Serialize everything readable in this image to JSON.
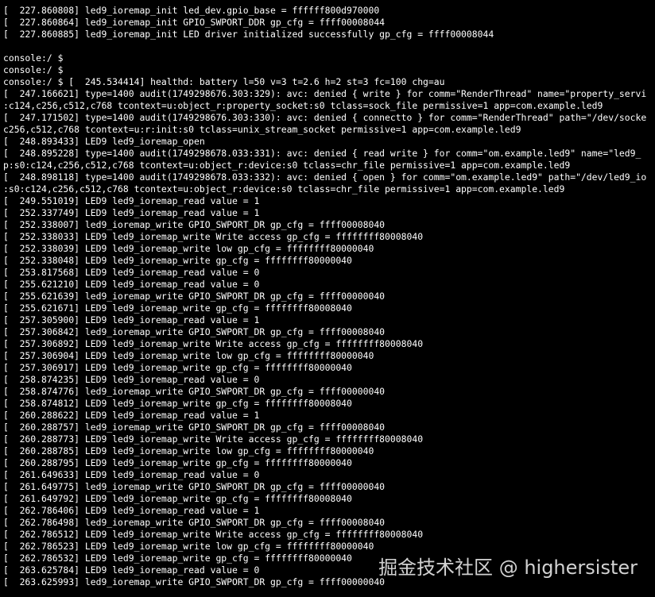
{
  "terminal": {
    "lines": [
      "[  227.860808] led9_ioremap_init led_dev.gpio_base = ffffff800d970000",
      "[  227.860864] led9_ioremap_init GPIO_SWPORT_DDR gp_cfg = ffff00008044",
      "[  227.860885] led9_ioremap_init LED driver initialized successfully gp_cfg = ffff00008044",
      "",
      "console:/ $",
      "console:/ $",
      "console:/ $ [  245.534414] healthd: battery l=50 v=3 t=2.6 h=2 st=3 fc=100 chg=au",
      "[  247.166621] type=1400 audit(1749298676.303:329): avc: denied { write } for comm=\"RenderThread\" name=\"property_servi",
      ":c124,c256,c512,c768 tcontext=u:object_r:property_socket:s0 tclass=sock_file permissive=1 app=com.example.led9",
      "[  247.171502] type=1400 audit(1749298676.303:330): avc: denied { connectto } for comm=\"RenderThread\" path=\"/dev/socke",
      "c256,c512,c768 tcontext=u:r:init:s0 tclass=unix_stream_socket permissive=1 app=com.example.led9",
      "[  248.893433] LED9 led9_ioremap_open",
      "[  248.895228] type=1400 audit(1749298678.033:331): avc: denied { read write } for comm=\"om.example.led9\" name=\"led9_",
      "p:s0:c124,c256,c512,c768 tcontext=u:object_r:device:s0 tclass=chr_file permissive=1 app=com.example.led9",
      "[  248.898118] type=1400 audit(1749298678.033:332): avc: denied { open } for comm=\"om.example.led9\" path=\"/dev/led9_io",
      ":s0:c124,c256,c512,c768 tcontext=u:object_r:device:s0 tclass=chr_file permissive=1 app=com.example.led9",
      "[  249.551019] LED9 led9_ioremap_read value = 1",
      "[  252.337749] LED9 led9_ioremap_read value = 1",
      "[  252.338007] led9_ioremap_write GPIO_SWPORT_DR gp_cfg = ffff00008040",
      "[  252.338033] LED9 led9_ioremap_write Write access gp_cfg = ffffffff80008040",
      "[  252.338039] LED9 led9_ioremap_write low gp_cfg = ffffffff80000040",
      "[  252.338048] LED9 led9_ioremap_write gp_cfg = ffffffff80000040",
      "[  253.817568] LED9 led9_ioremap_read value = 0",
      "[  255.621210] LED9 led9_ioremap_read value = 0",
      "[  255.621639] led9_ioremap_write GPIO_SWPORT_DR gp_cfg = ffff00000040",
      "[  255.621671] LED9 led9_ioremap_write gp_cfg = ffffffff80008040",
      "[  257.305900] LED9 led9_ioremap_read value = 1",
      "[  257.306842] led9_ioremap_write GPIO_SWPORT_DR gp_cfg = ffff00008040",
      "[  257.306892] LED9 led9_ioremap_write Write access gp_cfg = ffffffff80008040",
      "[  257.306904] LED9 led9_ioremap_write low gp_cfg = ffffffff80000040",
      "[  257.306917] LED9 led9_ioremap_write gp_cfg = ffffffff80000040",
      "[  258.874235] LED9 led9_ioremap_read value = 0",
      "[  258.874776] led9_ioremap_write GPIO_SWPORT_DR gp_cfg = ffff00000040",
      "[  258.874812] LED9 led9_ioremap_write gp_cfg = ffffffff80008040",
      "[  260.288622] LED9 led9_ioremap_read value = 1",
      "[  260.288757] led9_ioremap_write GPIO_SWPORT_DR gp_cfg = ffff00008040",
      "[  260.288773] LED9 led9_ioremap_write Write access gp_cfg = ffffffff80008040",
      "[  260.288785] LED9 led9_ioremap_write low gp_cfg = ffffffff80000040",
      "[  260.288795] LED9 led9_ioremap_write gp_cfg = ffffffff80000040",
      "[  261.649633] LED9 led9_ioremap_read value = 0",
      "[  261.649775] led9_ioremap_write GPIO_SWPORT_DR gp_cfg = ffff00000040",
      "[  261.649792] LED9 led9_ioremap_write gp_cfg = ffffffff80008040",
      "[  262.786406] LED9 led9_ioremap_read value = 1",
      "[  262.786498] led9_ioremap_write GPIO_SWPORT_DR gp_cfg = ffff00008040",
      "[  262.786512] LED9 led9_ioremap_write Write access gp_cfg = ffffffff80008040",
      "[  262.786523] LED9 led9_ioremap_write low gp_cfg = ffffffff80000040",
      "[  262.786532] LED9 led9_ioremap_write gp_cfg = ffffffff80000040",
      "[  263.625784] LED9 led9_ioremap_read value = 0",
      "[  263.625993] led9_ioremap_write GPIO_SWPORT_DR gp_cfg = ffff00000040"
    ]
  },
  "watermark": {
    "text": "掘金技术社区 @ highersister"
  },
  "colors": {
    "background": "#000000",
    "text": "#ffffff"
  }
}
